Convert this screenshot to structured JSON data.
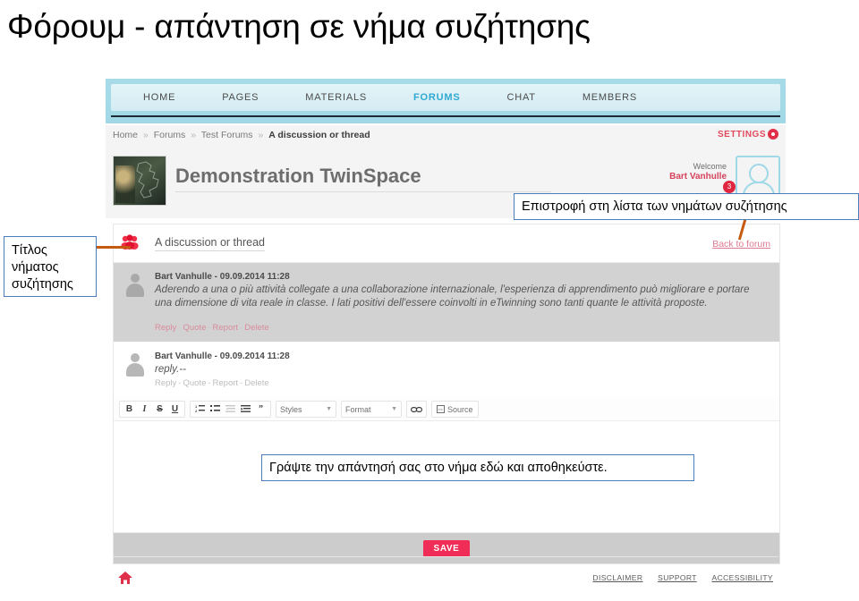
{
  "slide": {
    "title": "Φόρουμ - απάντηση σε νήμα συζήτησης"
  },
  "nav": {
    "items": [
      {
        "label": "HOME",
        "active": false
      },
      {
        "label": "PAGES",
        "active": false
      },
      {
        "label": "MATERIALS",
        "active": false
      },
      {
        "label": "FORUMS",
        "active": true
      },
      {
        "label": "CHAT",
        "active": false
      },
      {
        "label": "MEMBERS",
        "active": false
      }
    ]
  },
  "breadcrumb": {
    "items": [
      "Home",
      "Forums",
      "Test Forums",
      "A discussion or thread"
    ],
    "separator": "»",
    "home": "Home",
    "forums": "Forums",
    "test_forums": "Test Forums",
    "current": "A discussion or thread"
  },
  "settings": {
    "label": "SETTINGS",
    "icon": "gear-icon"
  },
  "space": {
    "title": "Demonstration TwinSpace",
    "welcome_label": "Welcome",
    "user_name": "Bart Vanhulle",
    "badge_count": "3"
  },
  "thread": {
    "title": "A discussion or thread",
    "back_link": "Back to forum",
    "posts": [
      {
        "author": "Bart Vanhulle",
        "timestamp": "09.09.2014 11:28",
        "meta": "Bart Vanhulle - 09.09.2014 11:28",
        "body": "Aderendo a una o più attività collegate a una collaborazione internazionale, l'esperienza di apprendimento può migliorare e portare una dimensione di vita reale in classe. I lati positivi dell'essere coinvolti in eTwinning sono tanti quante le attività proposte.",
        "actions": [
          "Reply",
          "Quote",
          "Report",
          "Delete"
        ]
      },
      {
        "author": "Bart Vanhulle",
        "timestamp": "09.09.2014 11:28",
        "meta": "Bart Vanhulle - 09.09.2014 11:28",
        "body": "reply.--",
        "actions": [
          "Reply",
          "Quote",
          "Report",
          "Delete"
        ]
      }
    ]
  },
  "editor": {
    "toolbar": {
      "bold": "B",
      "italic": "I",
      "strike": "S",
      "underline": "U",
      "ordered_list": "ordered-list-icon",
      "unordered_list": "unordered-list-icon",
      "outdent": "outdent-icon",
      "indent": "indent-icon",
      "blockquote": "blockquote-icon",
      "styles_label": "Styles",
      "format_label": "Format",
      "link": "link-icon",
      "source_label": "Source"
    },
    "content": "",
    "save_label": "SAVE"
  },
  "footer": {
    "home_icon": "home-icon",
    "links": [
      "DISCLAIMER",
      "SUPPORT",
      "ACCESSIBILITY"
    ],
    "disclaimer": "DISCLAIMER",
    "support": "SUPPORT",
    "accessibility": "ACCESSIBILITY"
  },
  "annotations": {
    "back_to_list": "Επιστροφή στη λίστα των νημάτων συζήτησης",
    "thread_title": "Τίτλος νήματος συζήτησης",
    "write_reply": "Γράψτε την απάντησή σας στο νήμα εδώ και αποθηκεύστε."
  },
  "colors": {
    "nav_band": "#a8dbe8",
    "nav_active": "#2fa9d4",
    "accent_red": "#ef2d56",
    "callout_border": "#4a7ebb",
    "leader": "#c55a11"
  }
}
